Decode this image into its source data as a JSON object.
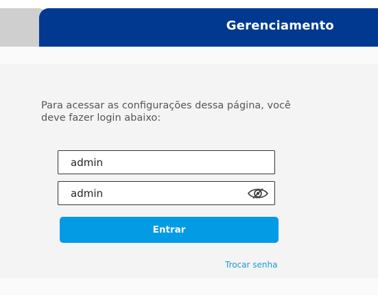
{
  "header": {
    "title": "Gerenciamento"
  },
  "login": {
    "instructions": "Para acessar as configurações dessa página, você deve fazer login abaixo:",
    "username_value": "admin",
    "password_value": "admin",
    "submit_label": "Entrar",
    "change_password_link": "Trocar senha"
  },
  "icons": {
    "password_toggle": "eye-icon"
  },
  "colors": {
    "header_bg": "#00398f",
    "button_bg": "#049be5",
    "link": "#1a9bd7"
  }
}
